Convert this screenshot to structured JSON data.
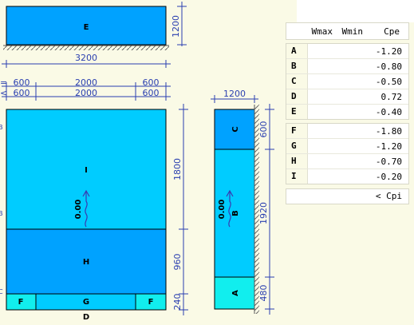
{
  "elevation": {
    "zone_label": "E",
    "width_label": "3200",
    "height_label": "1200"
  },
  "plan_dims": {
    "row1": [
      "600",
      "2000",
      "600"
    ],
    "row2": [
      "600",
      "2000",
      "600"
    ],
    "left_marks": [
      "=",
      "<"
    ]
  },
  "main_view": {
    "zones": [
      {
        "id": "I",
        "label": "I"
      },
      {
        "id": "H",
        "label": "H"
      },
      {
        "id": "F1",
        "label": "F"
      },
      {
        "id": "G",
        "label": "G"
      },
      {
        "id": "F2",
        "label": "F"
      }
    ],
    "bottom_label": "D",
    "level_label": "0.00",
    "vertical_dims": [
      "1800",
      "960",
      "240"
    ],
    "edge_marks": [
      "B",
      "B",
      "C"
    ]
  },
  "side_view": {
    "width_label": "1200",
    "zones": [
      {
        "id": "C",
        "label": "C"
      },
      {
        "id": "B",
        "label": "B"
      },
      {
        "id": "A",
        "label": "A"
      }
    ],
    "level_label": "0.00",
    "vertical_dims": [
      "600",
      "1920",
      "480"
    ]
  },
  "cpe_table": {
    "headers": {
      "wmax": "Wmax",
      "wmin": "Wmin",
      "cpe": "Cpe"
    },
    "group1": [
      {
        "id": "A",
        "cpe": "-1.20"
      },
      {
        "id": "B",
        "cpe": "-0.80"
      },
      {
        "id": "C",
        "cpe": "-0.50"
      },
      {
        "id": "D",
        "cpe": "0.72"
      },
      {
        "id": "E",
        "cpe": "-0.40"
      }
    ],
    "group2": [
      {
        "id": "F",
        "cpe": "-1.80"
      },
      {
        "id": "G",
        "cpe": "-1.20"
      },
      {
        "id": "H",
        "cpe": "-0.70"
      },
      {
        "id": "I",
        "cpe": "-0.20"
      }
    ],
    "cpi_label": "< Cpi"
  },
  "colors": {
    "zone_dark": "#00a2ff",
    "zone_light": "#00ccff",
    "zone_aqua": "#11eeee",
    "dim_line": "#2a3fb0"
  }
}
